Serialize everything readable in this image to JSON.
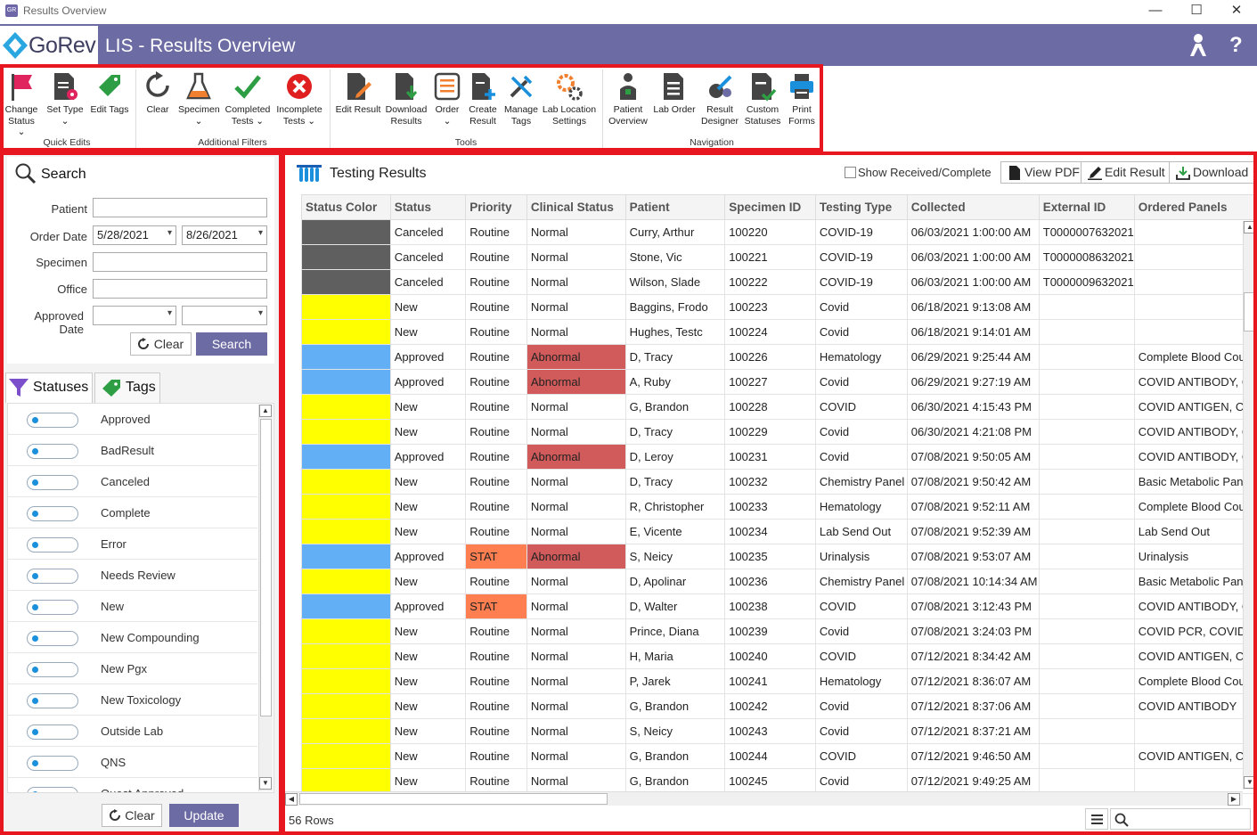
{
  "window": {
    "title": "Results Overview",
    "min": "—",
    "max": "☐",
    "close": "✕"
  },
  "header": {
    "logo": "GoRev",
    "title": "LIS - Results Overview"
  },
  "ribbon": {
    "buttons": [
      {
        "label": "Change\nStatus ⌄"
      },
      {
        "label": "Set Type\n⌄"
      },
      {
        "label": "Edit Tags"
      },
      {
        "label": "Clear"
      },
      {
        "label": "Specimen\n⌄"
      },
      {
        "label": "Completed\nTests ⌄"
      },
      {
        "label": "Incomplete\nTests ⌄"
      },
      {
        "label": "Edit Result"
      },
      {
        "label": "Download\nResults"
      },
      {
        "label": "Order\n⌄"
      },
      {
        "label": "Create\nResult"
      },
      {
        "label": "Manage\nTags"
      },
      {
        "label": "Lab Location\nSettings"
      },
      {
        "label": "Patient\nOverview"
      },
      {
        "label": "Lab Order"
      },
      {
        "label": "Result\nDesigner"
      },
      {
        "label": "Custom\nStatuses"
      },
      {
        "label": "Print\nForms"
      }
    ],
    "groups": {
      "quick": "Quick Edits",
      "filters": "Additional Filters",
      "tools": "Tools",
      "nav": "Navigation"
    }
  },
  "search": {
    "title": "Search",
    "patient_label": "Patient",
    "patient_value": "",
    "order_date_label": "Order Date",
    "order_from": "5/28/2021",
    "order_to": "8/26/2021",
    "specimen_label": "Specimen",
    "specimen_value": "",
    "office_label": "Office",
    "office_value": "",
    "approved_label": "Approved Date",
    "approved_from": "",
    "approved_to": "",
    "clear": "Clear",
    "search": "Search"
  },
  "tabs": {
    "statuses": "Statuses",
    "tags": "Tags"
  },
  "statuses": [
    "Approved",
    "BadResult",
    "Canceled",
    "Complete",
    "Error",
    "Needs Review",
    "New",
    "New Compounding",
    "New Pgx",
    "New Toxicology",
    "Outside Lab",
    "QNS",
    "Quest Approved"
  ],
  "bottom": {
    "clear": "Clear",
    "update": "Update"
  },
  "grid": {
    "title": "Testing Results",
    "show_received": "Show Received/Complete",
    "view_pdf": "View PDF",
    "edit_result": "Edit Result",
    "download": "Download",
    "columns": [
      "Status Color",
      "Status",
      "Priority",
      "Clinical Status",
      "Patient",
      "Specimen ID",
      "Testing Type",
      "Collected",
      "External ID",
      "Ordered Panels"
    ],
    "rows": [
      {
        "color": "#5f5f5f",
        "status": "Canceled",
        "priority": "Routine",
        "clinical": "Normal",
        "patient": "Curry, Arthur",
        "specimen": "100220",
        "type": "COVID-19",
        "collected": "06/03/2021 1:00:00 AM",
        "external": "T0000007632021",
        "panels": ""
      },
      {
        "color": "#5f5f5f",
        "status": "Canceled",
        "priority": "Routine",
        "clinical": "Normal",
        "patient": "Stone, Vic",
        "specimen": "100221",
        "type": "COVID-19",
        "collected": "06/03/2021 1:00:00 AM",
        "external": "T0000008632021",
        "panels": ""
      },
      {
        "color": "#5f5f5f",
        "status": "Canceled",
        "priority": "Routine",
        "clinical": "Normal",
        "patient": "Wilson, Slade",
        "specimen": "100222",
        "type": "COVID-19",
        "collected": "06/03/2021 1:00:00 AM",
        "external": "T0000009632021",
        "panels": ""
      },
      {
        "color": "#ffff00",
        "status": "New",
        "priority": "Routine",
        "clinical": "Normal",
        "patient": "Baggins, Frodo",
        "specimen": "100223",
        "type": "Covid",
        "collected": "06/18/2021 9:13:08 AM",
        "external": "",
        "panels": ""
      },
      {
        "color": "#ffff00",
        "status": "New",
        "priority": "Routine",
        "clinical": "Normal",
        "patient": "Hughes, Testc",
        "specimen": "100224",
        "type": "Covid",
        "collected": "06/18/2021 9:14:01 AM",
        "external": "",
        "panels": ""
      },
      {
        "color": "#63aff5",
        "status": "Approved",
        "priority": "Routine",
        "clinical": "Abnormal",
        "patient": "D, Tracy",
        "specimen": "100226",
        "type": "Hematology",
        "collected": "06/29/2021 9:25:44 AM",
        "external": "",
        "panels": "Complete Blood Cou"
      },
      {
        "color": "#63aff5",
        "status": "Approved",
        "priority": "Routine",
        "clinical": "Abnormal",
        "patient": "A, Ruby",
        "specimen": "100227",
        "type": "Covid",
        "collected": "06/29/2021 9:27:19 AM",
        "external": "",
        "panels": "COVID ANTIBODY, C"
      },
      {
        "color": "#ffff00",
        "status": "New",
        "priority": "Routine",
        "clinical": "Normal",
        "patient": "G, Brandon",
        "specimen": "100228",
        "type": "COVID",
        "collected": "06/30/2021 4:15:43 PM",
        "external": "",
        "panels": "COVID ANTIGEN, CC"
      },
      {
        "color": "#ffff00",
        "status": "New",
        "priority": "Routine",
        "clinical": "Normal",
        "patient": "D, Tracy",
        "specimen": "100229",
        "type": "Covid",
        "collected": "06/30/2021 4:21:08 PM",
        "external": "",
        "panels": "COVID ANTIBODY, C"
      },
      {
        "color": "#63aff5",
        "status": "Approved",
        "priority": "Routine",
        "clinical": "Abnormal",
        "patient": "D, Leroy",
        "specimen": "100231",
        "type": "Covid",
        "collected": "07/08/2021 9:50:05 AM",
        "external": "",
        "panels": "COVID ANTIBODY, C"
      },
      {
        "color": "#ffff00",
        "status": "New",
        "priority": "Routine",
        "clinical": "Normal",
        "patient": "D, Tracy",
        "specimen": "100232",
        "type": "Chemistry Panel",
        "collected": "07/08/2021 9:50:42 AM",
        "external": "",
        "panels": "Basic Metabolic Pane"
      },
      {
        "color": "#ffff00",
        "status": "New",
        "priority": "Routine",
        "clinical": "Normal",
        "patient": "R, Christopher",
        "specimen": "100233",
        "type": "Hematology",
        "collected": "07/08/2021 9:52:11 AM",
        "external": "",
        "panels": "Complete Blood Cou"
      },
      {
        "color": "#ffff00",
        "status": "New",
        "priority": "Routine",
        "clinical": "Normal",
        "patient": "E, Vicente",
        "specimen": "100234",
        "type": "Lab Send Out",
        "collected": "07/08/2021 9:52:39 AM",
        "external": "",
        "panels": "Lab Send Out"
      },
      {
        "color": "#63aff5",
        "status": "Approved",
        "priority": "STAT",
        "clinical": "Abnormal",
        "patient": "S, Neicy",
        "specimen": "100235",
        "type": "Urinalysis",
        "collected": "07/08/2021 9:53:07 AM",
        "external": "",
        "panels": "Urinalysis"
      },
      {
        "color": "#ffff00",
        "status": "New",
        "priority": "Routine",
        "clinical": "Normal",
        "patient": "D, Apolinar",
        "specimen": "100236",
        "type": "Chemistry Panel",
        "collected": "07/08/2021 10:14:34 AM",
        "external": "",
        "panels": "Basic Metabolic Pane"
      },
      {
        "color": "#63aff5",
        "status": "Approved",
        "priority": "STAT",
        "clinical": "Normal",
        "patient": "D, Walter",
        "specimen": "100238",
        "type": "COVID",
        "collected": "07/08/2021 3:12:43 PM",
        "external": "",
        "panels": "COVID ANTIBODY, C"
      },
      {
        "color": "#ffff00",
        "status": "New",
        "priority": "Routine",
        "clinical": "Normal",
        "patient": "Prince, Diana",
        "specimen": "100239",
        "type": "Covid",
        "collected": "07/08/2021 3:24:03 PM",
        "external": "",
        "panels": "COVID PCR, COVID A"
      },
      {
        "color": "#ffff00",
        "status": "New",
        "priority": "Routine",
        "clinical": "Normal",
        "patient": "H, Maria",
        "specimen": "100240",
        "type": "COVID",
        "collected": "07/12/2021 8:34:42 AM",
        "external": "",
        "panels": "COVID ANTIGEN, CC"
      },
      {
        "color": "#ffff00",
        "status": "New",
        "priority": "Routine",
        "clinical": "Normal",
        "patient": "P, Jarek",
        "specimen": "100241",
        "type": "Hematology",
        "collected": "07/12/2021 8:36:07 AM",
        "external": "",
        "panels": "Complete Blood Cou"
      },
      {
        "color": "#ffff00",
        "status": "New",
        "priority": "Routine",
        "clinical": "Normal",
        "patient": "G, Brandon",
        "specimen": "100242",
        "type": "Covid",
        "collected": "07/12/2021 8:37:06 AM",
        "external": "",
        "panels": "COVID ANTIBODY"
      },
      {
        "color": "#ffff00",
        "status": "New",
        "priority": "Routine",
        "clinical": "Normal",
        "patient": "S, Neicy",
        "specimen": "100243",
        "type": "Covid",
        "collected": "07/12/2021 8:37:21 AM",
        "external": "",
        "panels": ""
      },
      {
        "color": "#ffff00",
        "status": "New",
        "priority": "Routine",
        "clinical": "Normal",
        "patient": "G, Brandon",
        "specimen": "100244",
        "type": "COVID",
        "collected": "07/12/2021 9:46:50 AM",
        "external": "",
        "panels": "COVID ANTIGEN, CC"
      },
      {
        "color": "#ffff00",
        "status": "New",
        "priority": "Routine",
        "clinical": "Normal",
        "patient": "G, Brandon",
        "specimen": "100245",
        "type": "Covid",
        "collected": "07/12/2021 9:49:25 AM",
        "external": "",
        "panels": ""
      }
    ],
    "row_count": "56 Rows"
  },
  "colors": {
    "brand": "#6c6ba3",
    "highlight": "#e8161e",
    "abnormal": "#d15a5a",
    "stat": "#ff7f50"
  }
}
